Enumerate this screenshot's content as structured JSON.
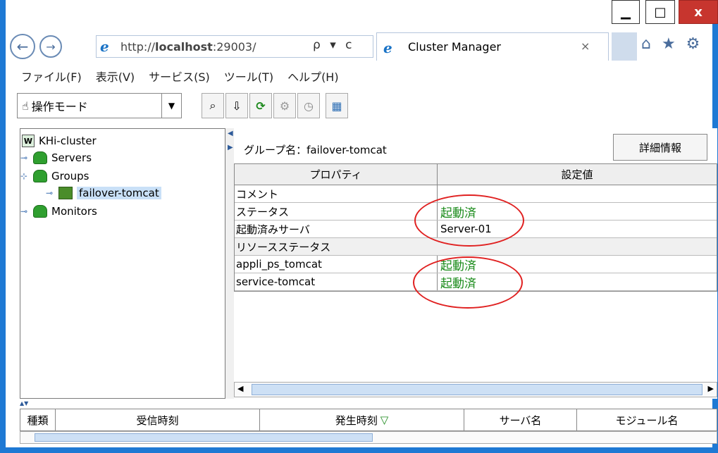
{
  "window": {
    "minimize_glyph": "▁",
    "maximize_glyph": "□",
    "close_glyph": "x"
  },
  "browser": {
    "back_glyph": "←",
    "forward_glyph": "→",
    "url_prefix": "http://",
    "url_host": "localhost",
    "url_suffix": ":29003/",
    "search_refresh": "ρ ▾ c",
    "tab_title": "Cluster Manager",
    "tab_close": "×",
    "toolbar_icons": "⌂ ★ ⚙"
  },
  "menu": {
    "items": [
      "ファイル(F)",
      "表示(V)",
      "サービス(S)",
      "ツール(T)",
      "ヘルプ(H)"
    ]
  },
  "toolbar": {
    "mode_label": "操作モード",
    "mode_arrow": "▼",
    "buttons": [
      "⌕",
      "⇩",
      "⟳",
      "⚙",
      "◷",
      "▦"
    ]
  },
  "tree": {
    "root": "KHi-cluster",
    "root_badge": "W",
    "servers": "Servers",
    "groups": "Groups",
    "group_item": "failover-tomcat",
    "monitors": "Monitors",
    "expand_glyph": "⊸",
    "collapse_glyph": "⊹"
  },
  "detail": {
    "group_label": "グループ名：failover-tomcat",
    "detail_button": "詳細情報",
    "col_property": "プロパティ",
    "col_value": "設定値",
    "rows": [
      {
        "prop": "コメント",
        "value": "",
        "section": false,
        "status": false
      },
      {
        "prop": "ステータス",
        "value": "起動済",
        "section": false,
        "status": true
      },
      {
        "prop": "起動済みサーバ",
        "value": "Server-01",
        "section": false,
        "status": false
      },
      {
        "prop": "リソースステータス",
        "value": "",
        "section": true,
        "status": false
      },
      {
        "prop": "appli_ps_tomcat",
        "value": "起動済",
        "section": false,
        "status": true
      },
      {
        "prop": "service-tomcat",
        "value": "起動済",
        "section": false,
        "status": true
      }
    ]
  },
  "events": {
    "columns": [
      "種類",
      "受信時刻",
      "発生時刻",
      "サーバ名",
      "モジュール名"
    ],
    "sort_glyph": "▽"
  },
  "colors": {
    "status_ok": "#188a18",
    "annotation": "#e02020",
    "frame": "#1e79d4"
  }
}
